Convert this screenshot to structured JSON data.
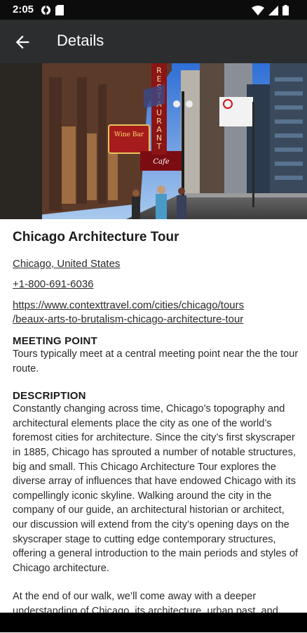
{
  "status": {
    "time": "2:05"
  },
  "app_bar": {
    "title": "Details"
  },
  "tour": {
    "title": "Chicago Architecture Tour",
    "location": "Chicago, United States",
    "phone": "+1-800-691-6036",
    "url_line1": "https://www.contexttravel.com/cities/chicago/tours",
    "url_line2": "/beaux-arts-to-brutalism-chicago-architecture-tour"
  },
  "meeting": {
    "heading": "MEETING POINT",
    "text": "Tours typically meet at a central meeting point near the the tour route."
  },
  "description": {
    "heading": "DESCRIPTION",
    "para1": "Constantly changing across time, Chicago’s topography and architectural elements place the city as one of the world’s foremost cities for architecture. Since the city’s first skyscraper in 1885, Chicago has sprouted a number of notable structures, big and small. This Chicago Architecture Tour explores the diverse array of influences that have endowed Chicago with its compellingly iconic skyline. Walking around the city in the company of our guide, an architectural historian or architect, our discussion will extend from the city’s opening days on the skyscraper stage to cutting edge contemporary structures, offering a general introduction to the main periods and styles of Chicago architecture.",
    "para2": "At the end of our walk, we’ll come away with a deeper understanding of Chicago, its architecture, urban past, and future development. We’ll also receive an orientation to the"
  },
  "hero": {
    "signs": {
      "restaurant_letters": "RESTAURANT",
      "wine": "Wine Bar",
      "cafe": "Cafe"
    }
  }
}
